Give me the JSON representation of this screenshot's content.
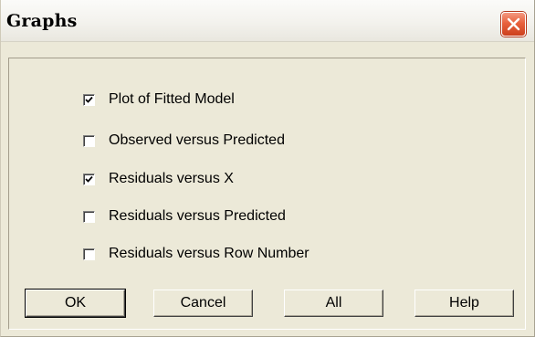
{
  "window": {
    "title": "Graphs"
  },
  "options": [
    {
      "label": "Plot of Fitted Model",
      "checked": true
    },
    {
      "label": "Observed versus Predicted",
      "checked": false
    },
    {
      "label": "Residuals versus X",
      "checked": true
    },
    {
      "label": "Residuals versus Predicted",
      "checked": false
    },
    {
      "label": "Residuals versus Row Number",
      "checked": false
    }
  ],
  "buttons": {
    "ok": "OK",
    "cancel": "Cancel",
    "all": "All",
    "help": "Help"
  },
  "colors": {
    "dialog_bg": "#ece9d8",
    "close_button": "#e8613d"
  },
  "icons": {
    "close": "close-icon",
    "check": "checkmark-icon"
  }
}
